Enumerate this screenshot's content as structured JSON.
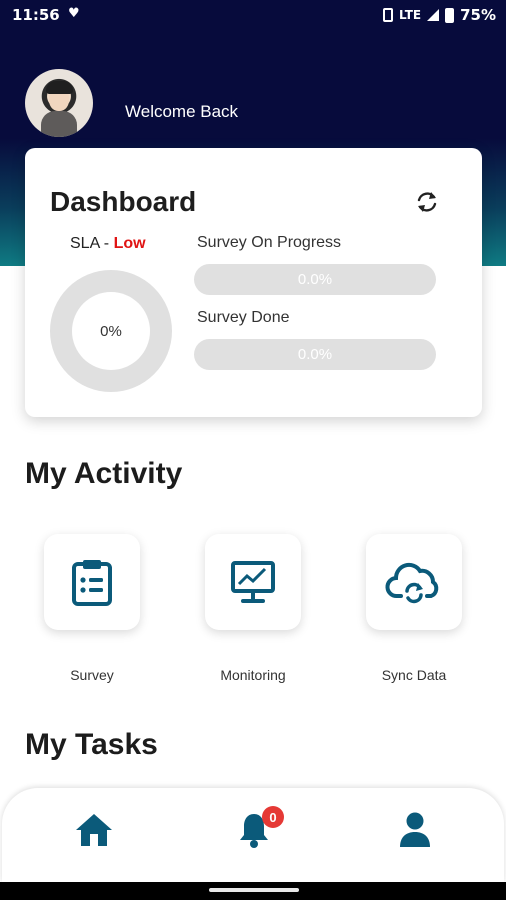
{
  "status_bar": {
    "time": "11:56",
    "network": "LTE",
    "battery": "75%"
  },
  "header": {
    "welcome_text": "Welcome Back"
  },
  "dashboard": {
    "title": "Dashboard",
    "sla_label": "SLA - ",
    "sla_status": "Low",
    "sla_percent": "0%",
    "survey_on_progress_label": "Survey On Progress",
    "survey_on_progress_value": "0.0%",
    "survey_done_label": "Survey Done",
    "survey_done_value": "0.0%"
  },
  "activity": {
    "title": "My Activity",
    "items": [
      {
        "label": "Survey",
        "icon": "clipboard-list-icon"
      },
      {
        "label": "Monitoring",
        "icon": "monitor-chart-icon"
      },
      {
        "label": "Sync Data",
        "icon": "cloud-sync-icon"
      }
    ]
  },
  "tasks": {
    "title": "My Tasks"
  },
  "bottom_nav": {
    "notification_count": "0",
    "items": [
      "home-icon",
      "bell-icon",
      "user-icon"
    ]
  },
  "colors": {
    "accent": "#0b5a7a",
    "header_dark": "#070b3c",
    "header_teal": "#0f7b83",
    "alert": "#e01414",
    "badge": "#e53935"
  }
}
